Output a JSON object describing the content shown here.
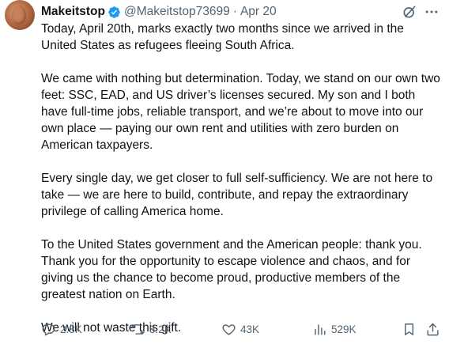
{
  "author": {
    "display_name": "Makeitstop",
    "handle": "@Makeitstop73699",
    "separator": "·",
    "date": "Apr 20",
    "verified": true
  },
  "icons": {
    "verified": "verified-badge-icon",
    "grok": "grok-icon",
    "more": "more-dots-icon"
  },
  "body": {
    "paragraphs": [
      "Today, April 20th, marks exactly two months since we arrived in the United States as refugees fleeing South Africa.",
      "We came with nothing but determination. Today, we stand on our own two feet: SSC, EAD, and US driver’s licenses secured. My son and I both have full-time jobs, reliable transport, and we’re about to move into our own place — paying our own rent and utilities with zero burden on American taxpayers.",
      "Every single day, we get closer to full self-sufficiency. We are not here to take — we are here to build, contribute, and repay the extraordinary privilege of calling America home.",
      "To the United States government and the American people: thank you. Thank you for the opportunity to escape violence and chaos, and for giving us the chance to become proud, productive members of the greatest nation on Earth.",
      "We will not waste this gift."
    ]
  },
  "actions": {
    "replies": "2.8K",
    "reposts": "8.2K",
    "likes": "43K",
    "views": "529K"
  },
  "colors": {
    "text": "#0f1419",
    "muted": "#536471",
    "verified": "#1d9bf0"
  }
}
